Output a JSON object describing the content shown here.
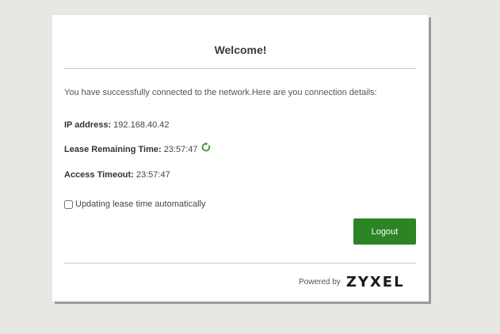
{
  "welcome": {
    "title": "Welcome!",
    "intro": "You have successfully connected to the network.Here are you connection details:"
  },
  "details": {
    "ip_label": "IP address:",
    "ip_value": "192.168.40.42",
    "lease_label": "Lease Remaining Time:",
    "lease_value": "23:57:47",
    "timeout_label": "Access Timeout:",
    "timeout_value": "23:57:47"
  },
  "auto_update": {
    "label": "Updating lease time automatically",
    "checked": false
  },
  "actions": {
    "logout_label": "Logout"
  },
  "footer": {
    "powered_by": "Powered by",
    "brand": "ZYXEL"
  },
  "icons": {
    "refresh": "refresh-icon"
  },
  "colors": {
    "accent": "#2c8424",
    "background": "#e8e7e3"
  }
}
